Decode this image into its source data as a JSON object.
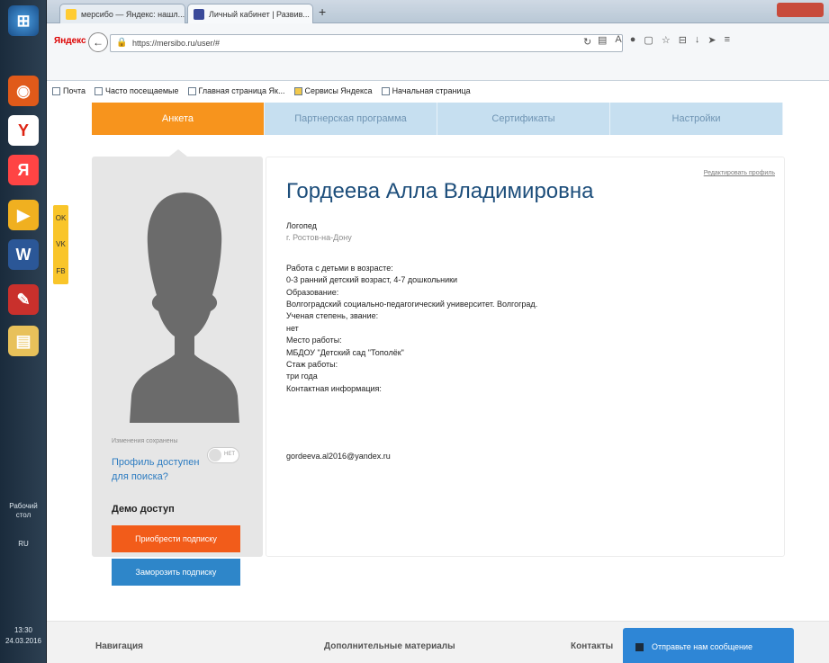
{
  "taskbar": {
    "desktop_label": "Рабочий стол",
    "lang": "RU",
    "time": "13:30",
    "date": "24.03.2016"
  },
  "browser": {
    "tabs": [
      {
        "label": "мерсибо — Яндекс: нашл...",
        "active": false
      },
      {
        "label": "Личный кабинет | Развив...",
        "active": true
      }
    ],
    "yandex_logo": "Яндекс",
    "url": "https://mersibo.ru/user/#",
    "bookmarks": [
      "Почта",
      "Часто посещаемые",
      "Главная страница Як...",
      "Сервисы Яндекса",
      "Начальная страница"
    ]
  },
  "social": {
    "items": [
      "OK",
      "VK",
      "FB"
    ]
  },
  "nav": {
    "tabs": [
      {
        "label": "Анкета",
        "active": true
      },
      {
        "label": "Партнерская программа",
        "active": false
      },
      {
        "label": "Сертификаты",
        "active": false
      },
      {
        "label": "Настройки",
        "active": false
      }
    ]
  },
  "sidebar": {
    "saved_label": "Изменения сохранены",
    "visibility_link": "Профиль доступен для поиска?",
    "toggle_label": "НЕТ",
    "demo_label": "Демо доступ",
    "buy_button": "Приобрести подписку",
    "freeze_button": "Заморозить подписку"
  },
  "profile": {
    "edit_link": "Редактировать профиль",
    "name": "Гордеева Алла Владимировна",
    "role": "Логопед",
    "city": "г. Ростов-на-Дону",
    "lines": [
      "Работа с детьми в возрасте:",
      "0-3 ранний детский возраст, 4-7 дошкольники",
      "Образование:",
      "Волгоградский социально-педагогический университет. Волгоград.",
      "Ученая степень, звание:",
      "нет",
      "Место работы:",
      "МБДОУ \"Детский сад \"Тополёк\"",
      "Стаж работы:",
      "три года",
      "Контактная информация:"
    ],
    "email": "gordeeva.al2016@yandex.ru"
  },
  "footer": {
    "col1": "Навигация",
    "col2": "Дополнительные материалы",
    "col3": "Контакты"
  },
  "chat": {
    "label": "Отправьте нам сообщение"
  },
  "colors": {
    "accent": "#f7941d",
    "link": "#2d7cc1",
    "title": "#1d4e7b",
    "buy": "#f25c1a",
    "freeze": "#2e86c9"
  }
}
